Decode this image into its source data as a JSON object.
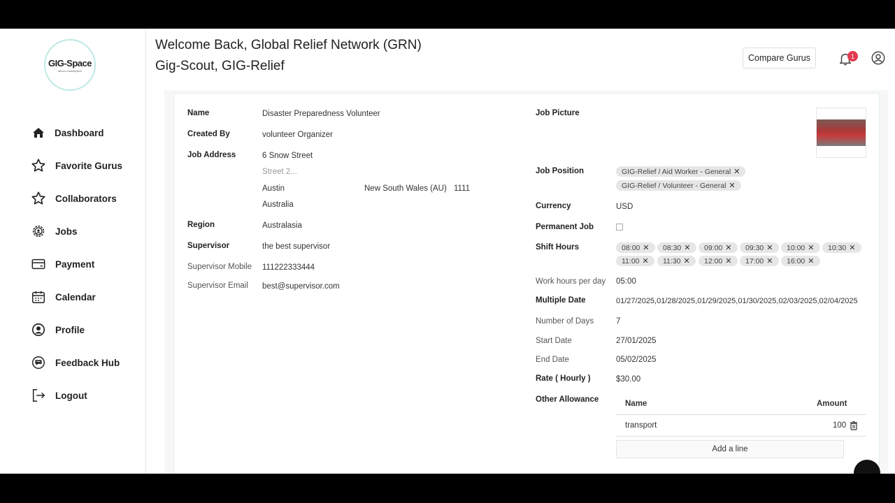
{
  "app": {
    "logo_text": "GIG-Space",
    "logo_subtitle": "labour marketplace"
  },
  "sidebar": {
    "items": [
      {
        "label": "Dashboard",
        "icon": "home-icon"
      },
      {
        "label": "Favorite Gurus",
        "icon": "star-icon"
      },
      {
        "label": "Collaborators",
        "icon": "star-icon"
      },
      {
        "label": "Jobs",
        "icon": "gear-icon"
      },
      {
        "label": "Payment",
        "icon": "card-icon"
      },
      {
        "label": "Calendar",
        "icon": "calendar-icon"
      },
      {
        "label": "Profile",
        "icon": "user-circle-icon"
      },
      {
        "label": "Feedback Hub",
        "icon": "chat-icon"
      },
      {
        "label": "Logout",
        "icon": "logout-icon"
      }
    ]
  },
  "header": {
    "welcome": "Welcome Back, Global Relief Network (GRN)",
    "subtitle": "Gig-Scout, GIG-Relief",
    "compare_label": "Compare Gurus",
    "notification_count": "1"
  },
  "job": {
    "name_label": "Name",
    "name": "Disaster Preparedness Volunteer",
    "created_by_label": "Created By",
    "created_by": "volunteer  Organizer",
    "address_label": "Job Address",
    "street1": "6 Snow Street",
    "street2_placeholder": "Street 2...",
    "city": "Austin",
    "state": "New South Wales (AU)",
    "zip": "1111",
    "country": "Australia",
    "region_label": "Region",
    "region": "Australasia",
    "supervisor_label": "Supervisor",
    "supervisor": "the best supervisor",
    "supervisor_mobile_label": "Supervisor Mobile",
    "supervisor_mobile": "111222333444",
    "supervisor_email_label": "Supervisor Email",
    "supervisor_email": "best@supervisor.com",
    "picture_label": "Job Picture",
    "position_label": "Job Position",
    "positions": [
      "GIG-Relief / Aid Worker - General",
      "GIG-Relief / Volunteer - General"
    ],
    "currency_label": "Currency",
    "currency": "USD",
    "permanent_label": "Permanent Job",
    "permanent": false,
    "shift_label": "Shift Hours",
    "shifts": [
      "08:00",
      "08:30",
      "09:00",
      "09:30",
      "10:00",
      "10:30",
      "11:00",
      "11:30",
      "12:00",
      "17:00",
      "16:00"
    ],
    "work_hours_label": "Work hours per day",
    "work_hours": "05:00",
    "multiple_date_label": "Multiple Date",
    "multiple_date": "01/27/2025,01/28/2025,01/29/2025,01/30/2025,02/03/2025,02/04/2025",
    "num_days_label": "Number of Days",
    "num_days": "7",
    "start_label": "Start Date",
    "start": "27/01/2025",
    "end_label": "End Date",
    "end": "05/02/2025",
    "rate_label": "Rate ( Hourly )",
    "rate": "$30.00",
    "allowance_label": "Other Allowance",
    "allowance_table": {
      "col_name": "Name",
      "col_amount": "Amount",
      "rows": [
        {
          "name": "transport",
          "amount": "100"
        }
      ],
      "add_label": "Add a line"
    }
  }
}
